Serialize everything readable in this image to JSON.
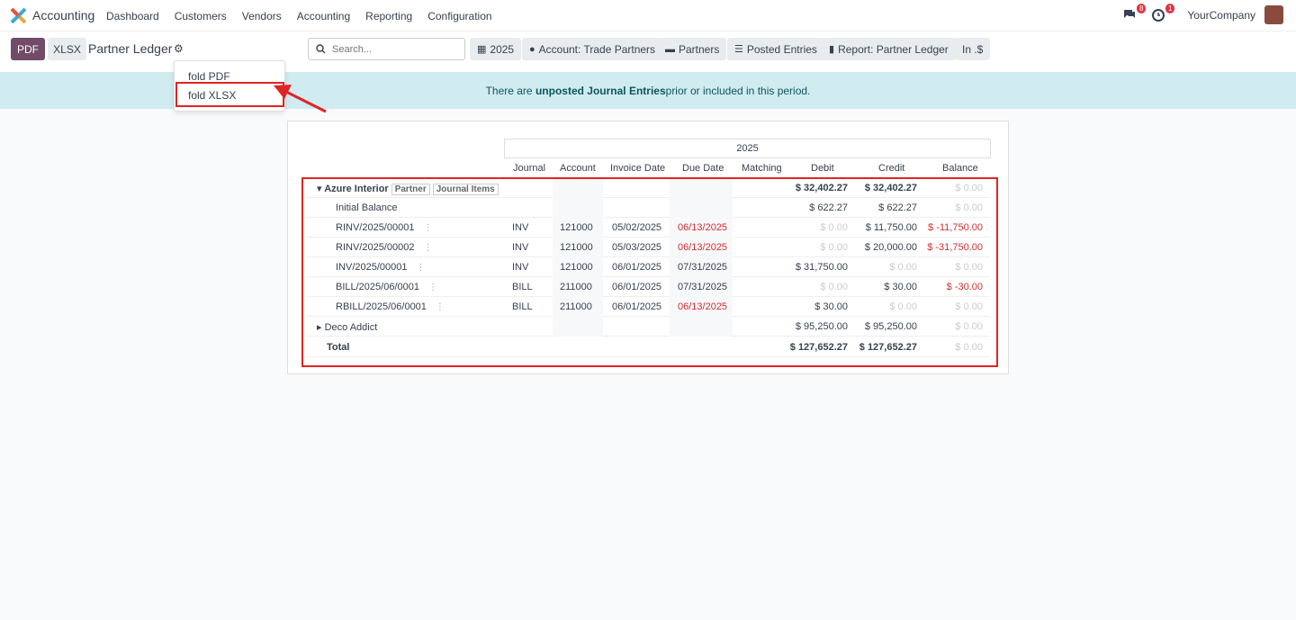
{
  "nav": {
    "app_name": "Accounting",
    "menu": [
      "Dashboard",
      "Customers",
      "Vendors",
      "Accounting",
      "Reporting",
      "Configuration"
    ],
    "chat_badge": "8",
    "activity_badge": "1",
    "company": "YourCompany"
  },
  "control": {
    "pdf_label": "PDF",
    "xlsx_label": "XLSX",
    "title": "Partner Ledger",
    "search_placeholder": "Search...",
    "filters": [
      {
        "icon": "calendar-icon",
        "label": "2025"
      },
      {
        "icon": "user-icon",
        "label": "Account: Trade Partners"
      },
      {
        "icon": "folder-icon",
        "label": "Partners"
      },
      {
        "icon": "sliders-icon",
        "label": "Posted Entries"
      },
      {
        "icon": "book-icon",
        "label": "Report: Partner Ledger"
      },
      {
        "icon": "",
        "label": "In .$"
      }
    ]
  },
  "dropdown": {
    "items": [
      "fold PDF",
      "fold XLSX"
    ]
  },
  "banner": {
    "prefix": "There are ",
    "strong": "unposted Journal Entries",
    "suffix": " prior or included in this period."
  },
  "report": {
    "period": "2025",
    "columns": [
      "Journal",
      "Account",
      "Invoice Date",
      "Due Date",
      "Matching",
      "Debit",
      "Credit",
      "Balance"
    ],
    "partner": {
      "name": "Azure Interior",
      "tag1": "Partner",
      "tag2": "Journal Items",
      "debit": "$ 32,402.27",
      "credit": "$ 32,402.27",
      "balance": "$ 0.00"
    },
    "initial": {
      "label": "Initial Balance",
      "debit": "$ 622.27",
      "credit": "$ 622.27",
      "balance": "$ 0.00"
    },
    "lines": [
      {
        "ref": "RINV/2025/00001",
        "journal": "INV",
        "account": "121000",
        "invoice_date": "05/02/2025",
        "due_date": "06/13/2025",
        "debit": "$ 0.00",
        "credit": "$ 11,750.00",
        "balance": "$ -11,750.00"
      },
      {
        "ref": "RINV/2025/00002",
        "journal": "INV",
        "account": "121000",
        "invoice_date": "05/03/2025",
        "due_date": "06/13/2025",
        "debit": "$ 0.00",
        "credit": "$ 20,000.00",
        "balance": "$ -31,750.00"
      },
      {
        "ref": "INV/2025/00001",
        "journal": "INV",
        "account": "121000",
        "invoice_date": "06/01/2025",
        "due_date": "07/31/2025",
        "debit": "$ 31,750.00",
        "credit": "$ 0.00",
        "balance": "$ 0.00"
      },
      {
        "ref": "BILL/2025/06/0001",
        "journal": "BILL",
        "account": "211000",
        "invoice_date": "06/01/2025",
        "due_date": "07/31/2025",
        "debit": "$ 0.00",
        "credit": "$ 30.00",
        "balance": "$ -30.00"
      },
      {
        "ref": "RBILL/2025/06/0001",
        "journal": "BILL",
        "account": "211000",
        "invoice_date": "06/01/2025",
        "due_date": "06/13/2025",
        "debit": "$ 30.00",
        "credit": "$ 0.00",
        "balance": "$ 0.00"
      }
    ],
    "partner2": {
      "name": "Deco Addict",
      "debit": "$ 95,250.00",
      "credit": "$ 95,250.00",
      "balance": "$ 0.00"
    },
    "total": {
      "label": "Total",
      "debit": "$ 127,652.27",
      "credit": "$ 127,652.27",
      "balance": "$ 0.00"
    }
  },
  "colors": {
    "accent": "#714b67",
    "danger": "#d32f2f",
    "info_bg": "#d1ecf1"
  }
}
